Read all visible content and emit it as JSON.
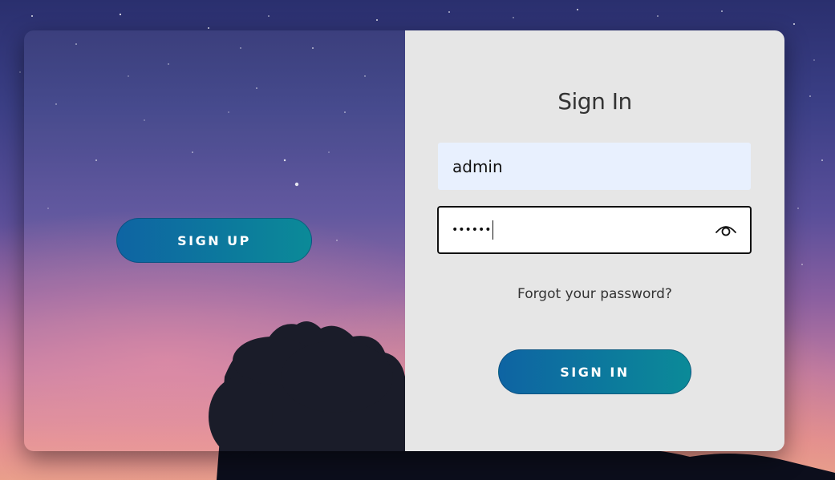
{
  "overlay": {
    "signup_label": "SIGN UP"
  },
  "form": {
    "title": "Sign In",
    "username_value": "admin",
    "password_masked": "••••••",
    "forgot_label": "Forgot your password?",
    "signin_label": "SIGN IN"
  },
  "icons": {
    "password_toggle": "eye-icon"
  },
  "colors": {
    "button_gradient_start": "#0e64a3",
    "button_gradient_end": "#0b8a98",
    "form_background": "#e6e6e6",
    "autofill_background": "#e8f0fe"
  }
}
